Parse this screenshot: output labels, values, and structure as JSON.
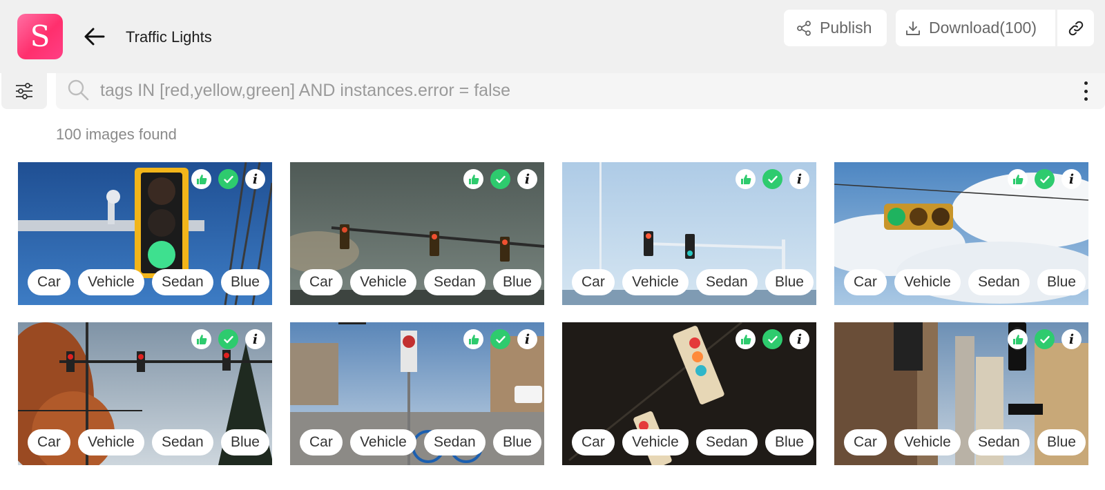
{
  "app": {
    "logo_letter": "S",
    "title": "Traffic Lights"
  },
  "toolbar": {
    "publish_label": "Publish",
    "download_label": "Download(100)"
  },
  "search": {
    "query": "tags IN [red,yellow,green] AND instances.error = false"
  },
  "results": {
    "count_text": "100 images found"
  },
  "colors": {
    "accent_pink": "#ff3f85",
    "check_green": "#2ecb6e"
  },
  "cards": [
    {
      "tags": [
        "Car",
        "Vehicle",
        "Sedan",
        "Blue"
      ]
    },
    {
      "tags": [
        "Car",
        "Vehicle",
        "Sedan",
        "Blue"
      ]
    },
    {
      "tags": [
        "Car",
        "Vehicle",
        "Sedan",
        "Blue"
      ]
    },
    {
      "tags": [
        "Car",
        "Vehicle",
        "Sedan",
        "Blue"
      ]
    },
    {
      "tags": [
        "Car",
        "Vehicle",
        "Sedan",
        "Blue"
      ]
    },
    {
      "tags": [
        "Car",
        "Vehicle",
        "Sedan",
        "Blue"
      ]
    },
    {
      "tags": [
        "Car",
        "Vehicle",
        "Sedan",
        "Blue"
      ]
    },
    {
      "tags": [
        "Car",
        "Vehicle",
        "Sedan",
        "Blue"
      ]
    }
  ]
}
